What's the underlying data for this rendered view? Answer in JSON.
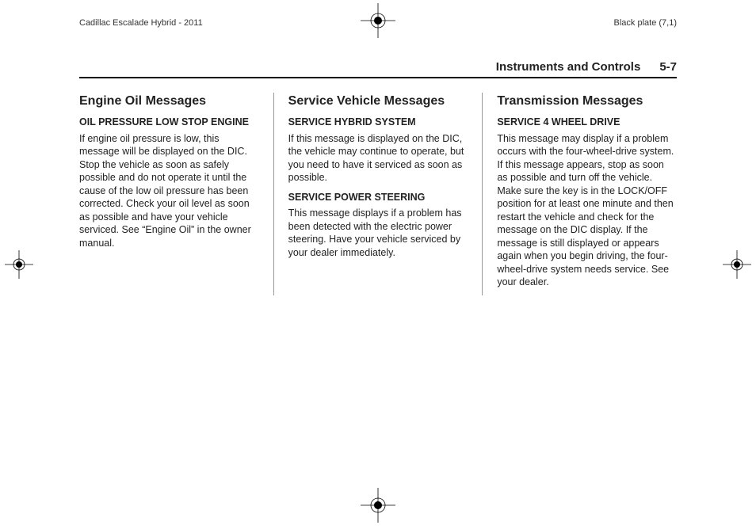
{
  "meta": {
    "vehicle": "Cadillac Escalade Hybrid - 2011",
    "plate": "Black plate (7,1)"
  },
  "header": {
    "section": "Instruments and Controls",
    "page": "5-7"
  },
  "columns": [
    {
      "title": "Engine Oil Messages",
      "blocks": [
        {
          "heading": "OIL PRESSURE LOW STOP ENGINE",
          "body": "If engine oil pressure is low, this message will be displayed on the DIC. Stop the vehicle as soon as safely possible and do not operate it until the cause of the low oil pressure has been corrected. Check your oil level as soon as possible and have your vehicle serviced. See “Engine Oil” in the owner manual."
        }
      ]
    },
    {
      "title": "Service Vehicle Messages",
      "blocks": [
        {
          "heading": "SERVICE HYBRID SYSTEM",
          "body": "If this message is displayed on the DIC, the vehicle may continue to operate, but you need to have it serviced as soon as possible."
        },
        {
          "heading": "SERVICE POWER STEERING",
          "body": "This message displays if a problem has been detected with the electric power steering. Have your vehicle serviced by your dealer immediately."
        }
      ]
    },
    {
      "title": "Transmission Messages",
      "blocks": [
        {
          "heading": "SERVICE 4 WHEEL DRIVE",
          "body": "This message may display if a problem occurs with the four-wheel-drive system. If this message appears, stop as soon as possible and turn off the vehicle. Make sure the key is in the LOCK/OFF position for at least one minute and then restart the vehicle and check for the message on the DIC display. If the message is still displayed or appears again when you begin driving, the four-wheel-drive system needs service. See your dealer."
        }
      ]
    }
  ]
}
